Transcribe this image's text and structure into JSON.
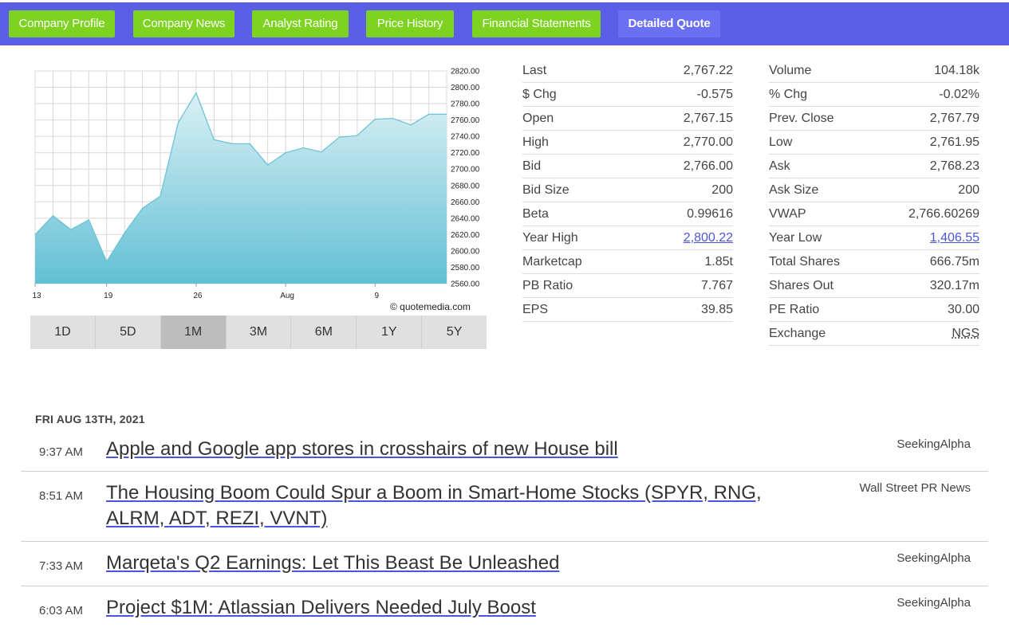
{
  "nav": {
    "tabs": [
      {
        "label": "Company Profile"
      },
      {
        "label": "Company News"
      },
      {
        "label": "Analyst Rating"
      },
      {
        "label": "Price History"
      },
      {
        "label": "Financial Statements"
      },
      {
        "label": "Detailed Quote"
      }
    ],
    "active_tab": "Detailed Quote"
  },
  "chart_data": {
    "type": "area",
    "x_tick_labels": [
      "13",
      "19",
      "26",
      "Aug",
      "9"
    ],
    "y_ticks": [
      2560,
      2580,
      2600,
      2620,
      2640,
      2660,
      2680,
      2700,
      2720,
      2740,
      2760,
      2780,
      2800,
      2820
    ],
    "ylim": [
      2560,
      2820
    ],
    "values": [
      2620,
      2643,
      2626,
      2638,
      2587,
      2622,
      2652,
      2667,
      2757,
      2793,
      2736,
      2731,
      2731,
      2705,
      2720,
      2726,
      2721,
      2739,
      2741,
      2761,
      2762,
      2754,
      2767,
      2767
    ],
    "grid": true,
    "watermark": "© quotemedia.com",
    "colors": {
      "line": "#6cc3d5",
      "fill_top": "#dbf0f5",
      "fill_bottom": "#62c0d4"
    }
  },
  "ranges": {
    "buttons": [
      "1D",
      "5D",
      "1M",
      "3M",
      "6M",
      "1Y",
      "5Y"
    ],
    "active": "1M"
  },
  "quote_left": [
    {
      "label": "Last",
      "value": "2,767.22"
    },
    {
      "label": "$ Chg",
      "value": "-0.575"
    },
    {
      "label": "Open",
      "value": "2,767.15"
    },
    {
      "label": "High",
      "value": "2,770.00"
    },
    {
      "label": "Bid",
      "value": "2,766.00"
    },
    {
      "label": "Bid Size",
      "value": "200"
    },
    {
      "label": "Beta",
      "value": "0.99616"
    },
    {
      "label": "Year High",
      "value": "2,800.22"
    },
    {
      "label": "Marketcap",
      "value": "1.85t"
    },
    {
      "label": "PB Ratio",
      "value": "7.767"
    },
    {
      "label": "EPS",
      "value": "39.85"
    }
  ],
  "quote_right": [
    {
      "label": "Volume",
      "value": "104.18k"
    },
    {
      "label": "% Chg",
      "value": "-0.02%"
    },
    {
      "label": "Prev. Close",
      "value": "2,767.79"
    },
    {
      "label": "Low",
      "value": "2,761.95"
    },
    {
      "label": "Ask",
      "value": "2,768.23"
    },
    {
      "label": "Ask Size",
      "value": "200"
    },
    {
      "label": "VWAP",
      "value": "2,766.60269"
    },
    {
      "label": "Year Low",
      "value": "1,406.55"
    },
    {
      "label": "Total Shares",
      "value": "666.75m"
    },
    {
      "label": "Shares Out",
      "value": "320.17m"
    },
    {
      "label": "PE Ratio",
      "value": "30.00"
    },
    {
      "label": "Exchange",
      "value": "NGS"
    }
  ],
  "news": {
    "date": "FRI AUG 13TH, 2021",
    "items": [
      {
        "time": "9:37 AM",
        "title": "Apple and Google app stores in crosshairs of new House bill",
        "source": "SeekingAlpha"
      },
      {
        "time": "8:51 AM",
        "title": "The Housing Boom Could Spur a Boom in Smart-Home Stocks (SPYR, RNG, ALRM, ADT, REZI, VVNT)",
        "source": "Wall Street PR News"
      },
      {
        "time": "7:33 AM",
        "title": "Marqeta's Q2 Earnings: Let This Beast Be Unleashed",
        "source": "SeekingAlpha"
      },
      {
        "time": "6:03 AM",
        "title": "Project $1M: Atlassian Delivers Needed July Boost",
        "source": "SeekingAlpha"
      }
    ]
  }
}
